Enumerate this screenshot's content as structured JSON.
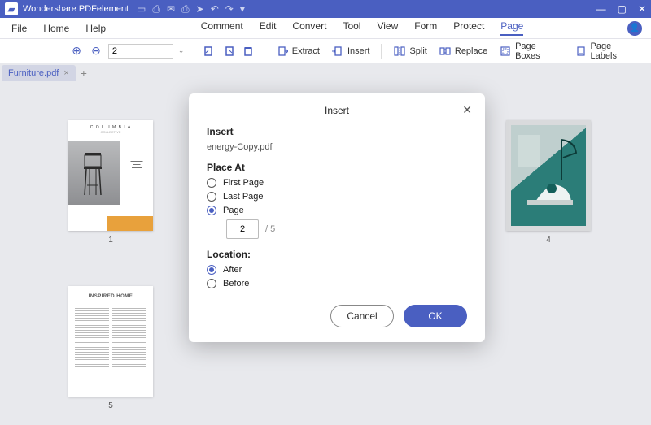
{
  "app": {
    "title": "Wondershare PDFelement"
  },
  "window_controls": {
    "min": "—",
    "max": "▢",
    "close": "✕"
  },
  "qat": [
    "folder-open",
    "save",
    "mail",
    "print",
    "share",
    "undo",
    "redo",
    "dropdown"
  ],
  "menubar": {
    "left": [
      "File",
      "Home",
      "Help"
    ],
    "center": [
      "Comment",
      "Edit",
      "Convert",
      "Tool",
      "View",
      "Form",
      "Protect",
      "Page"
    ],
    "active": "Page"
  },
  "toolbar": {
    "page_field": "2",
    "items": [
      {
        "id": "extract",
        "label": "Extract"
      },
      {
        "id": "insert",
        "label": "Insert"
      },
      {
        "id": "split",
        "label": "Split"
      },
      {
        "id": "replace",
        "label": "Replace"
      },
      {
        "id": "page-boxes",
        "label": "Page Boxes"
      },
      {
        "id": "page-labels",
        "label": "Page Labels"
      }
    ]
  },
  "tabs": {
    "current": "Furniture.pdf"
  },
  "thumbnails": {
    "p1": {
      "num": "1",
      "brand1": "C O L U M B I A",
      "brand2": "COLLECTIVE"
    },
    "p4": {
      "num": "4"
    },
    "p5": {
      "num": "5",
      "title": "INSPIRED HOME"
    }
  },
  "dialog": {
    "title": "Insert",
    "section_insert": "Insert",
    "filename": "energy-Copy.pdf",
    "section_placeat": "Place At",
    "opt_first": "First Page",
    "opt_last": "Last Page",
    "opt_page": "Page",
    "page_value": "2",
    "page_total": "/  5",
    "section_location": "Location:",
    "opt_after": "After",
    "opt_before": "Before",
    "cancel": "Cancel",
    "ok": "OK"
  }
}
